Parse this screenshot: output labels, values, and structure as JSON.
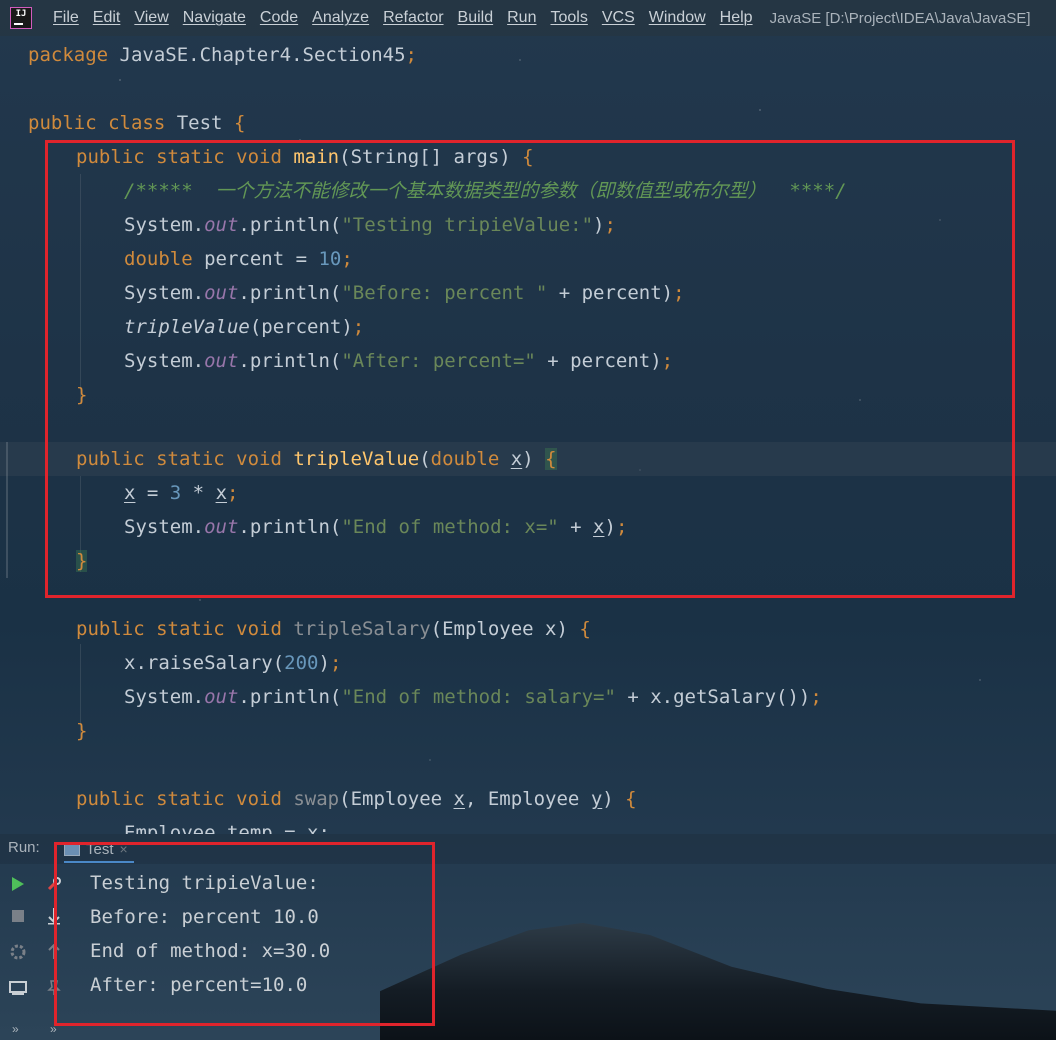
{
  "window": {
    "title": "JavaSE [D:\\Project\\IDEA\\Java\\JavaSE]",
    "logo_text": "IJ"
  },
  "menu": [
    "File",
    "Edit",
    "View",
    "Navigate",
    "Code",
    "Analyze",
    "Refactor",
    "Build",
    "Run",
    "Tools",
    "VCS",
    "Window",
    "Help"
  ],
  "code": {
    "package_kw": "package",
    "package_name": "JavaSE.Chapter4.Section45",
    "class_kw": "public class",
    "class_name": "Test",
    "comment": "/*****  一个方法不能修改一个基本数据类型的参数（即数值型或布尔型）  ****/",
    "str_testing": "\"Testing tripieValue:\"",
    "str_before": "\"Before: percent \"",
    "str_after": "\"After: percent=\"",
    "str_end_x": "\"End of method: x=\"",
    "str_end_salary": "\"End of method: salary=\"",
    "num_10": "10",
    "num_3": "3",
    "num_200": "200",
    "partial_line": "Employee temp = x;"
  },
  "run_panel": {
    "label": "Run:",
    "tab_name": "Test",
    "tab_close": "×",
    "console_lines": [
      "Testing tripieValue:",
      "Before: percent 10.0",
      "End of method: x=30.0",
      "After: percent=10.0"
    ],
    "expand_glyph": "»"
  },
  "colors": {
    "highlight_box": "#e0242c",
    "keyword": "#d08a3c",
    "string": "#6a8759",
    "number": "#6897bb",
    "method_decl": "#ffc66d",
    "static_field": "#9876aa",
    "comment": "#629755"
  },
  "icons": [
    "run-icon",
    "stop-icon",
    "debug-settings-icon",
    "layout-icon",
    "rerun-wrench-icon",
    "scroll-down-icon",
    "scroll-up-icon",
    "pin-icon"
  ]
}
